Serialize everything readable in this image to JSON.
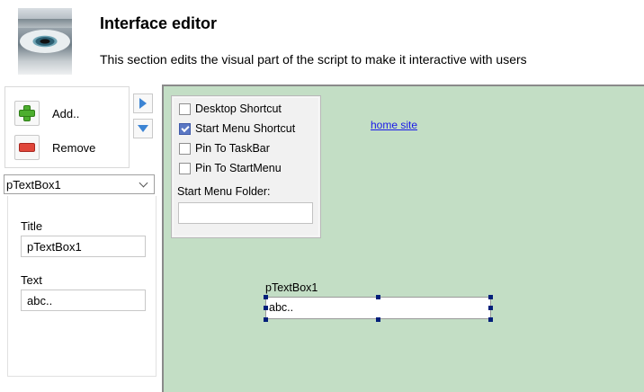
{
  "header": {
    "title": "Interface editor",
    "subtitle": "This section edits the visual part of the script to make it interactive with users",
    "logo_icon": "eye-icon"
  },
  "toolbar": {
    "add_label": "Add..",
    "remove_label": "Remove",
    "add_icon": "plus-icon",
    "remove_icon": "minus-icon",
    "move_right_icon": "arrow-right-icon",
    "move_down_icon": "arrow-down-icon"
  },
  "selector": {
    "value": "pTextBox1"
  },
  "properties": {
    "title_label": "Title",
    "title_value": "pTextBox1",
    "text_label": "Text",
    "text_value": "abc.."
  },
  "canvas": {
    "background_color": "#c3dec5",
    "checkboxes": [
      {
        "label": "Desktop Shortcut",
        "checked": false
      },
      {
        "label": "Start Menu Shortcut",
        "checked": true
      },
      {
        "label": "Pin To TaskBar",
        "checked": false
      },
      {
        "label": "Pin To StartMenu",
        "checked": false
      }
    ],
    "folder_label": "Start Menu Folder:",
    "folder_value": "",
    "link_text": "home site",
    "field_label": "pTextBox1",
    "field_value": "abc.."
  }
}
